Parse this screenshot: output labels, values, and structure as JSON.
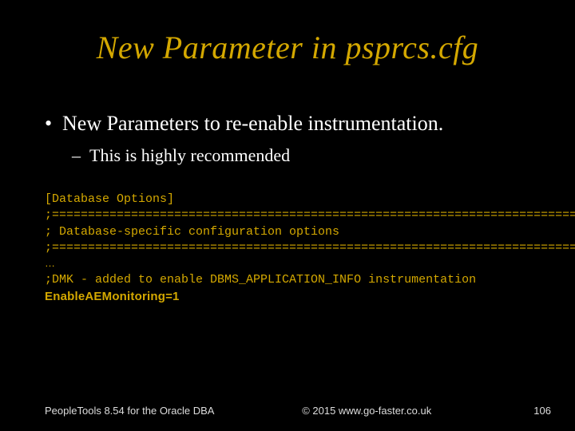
{
  "title": "New Parameter in psprcs.cfg",
  "bullets": {
    "main": "New Parameters to re-enable instrumentation.",
    "sub": "This is highly recommended"
  },
  "code": {
    "l1": "[Database Options]",
    "l2": ";=========================================================================",
    "l3": "; Database-specific configuration options",
    "l4": ";=========================================================================",
    "l5": "…",
    "l6": ";DMK - added to enable DBMS_APPLICATION_INFO instrumentation",
    "l7": "EnableAEMonitoring=1"
  },
  "footer": {
    "left": "PeopleTools 8.54 for the Oracle DBA",
    "center": "© 2015 www.go-faster.co.uk",
    "right": "106"
  }
}
